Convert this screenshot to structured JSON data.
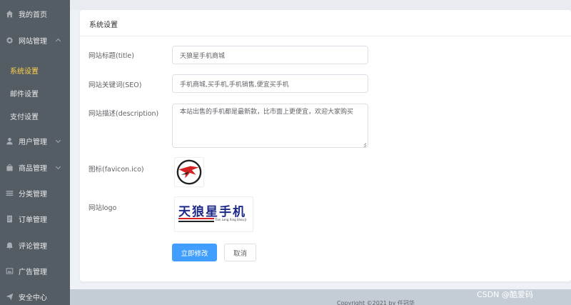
{
  "sidebar": {
    "items": [
      {
        "label": "我的首页",
        "icon": "home-icon"
      },
      {
        "label": "网站管理",
        "icon": "gear-icon",
        "expanded": true,
        "children": [
          {
            "label": "系统设置",
            "active": true
          },
          {
            "label": "邮件设置"
          },
          {
            "label": "支付设置"
          }
        ]
      },
      {
        "label": "用户管理",
        "icon": "user-icon",
        "expandable": true
      },
      {
        "label": "商品管理",
        "icon": "bag-icon",
        "expandable": true
      },
      {
        "label": "分类管理",
        "icon": "category-icon"
      },
      {
        "label": "订单管理",
        "icon": "order-icon"
      },
      {
        "label": "评论管理",
        "icon": "comment-icon"
      },
      {
        "label": "广告管理",
        "icon": "picture-icon"
      },
      {
        "label": "安全中心",
        "icon": "send-icon"
      }
    ],
    "active_color": "#ffd04b",
    "background": "#545c64"
  },
  "card": {
    "title": "系统设置"
  },
  "form": {
    "title_label": "网站标题(title)",
    "title_value": "天狼星手机商城",
    "keywords_label": "网站关键词(SEO)",
    "keywords_value": "手机商城,买手机,手机销售,便宜买手机",
    "description_label": "网站描述(description)",
    "description_value": "本站出售的手机都是最新款，比市面上更便宜，欢迎大家购买",
    "favicon_label": "图标(favicon.ico)",
    "logo_label": "网站logo",
    "logo_text": "天狼星手机",
    "logo_subtext": "Tian Lang Xing Shou Ji",
    "submit_label": "立即修改",
    "cancel_label": "取消"
  },
  "footer": {
    "text": "Copyright ©2021 by 任冠华"
  },
  "watermark": "CSDN @酷爱码",
  "colors": {
    "primary": "#409eff",
    "sidebar_bg": "#545c64",
    "active_menu": "#ffd04b"
  }
}
